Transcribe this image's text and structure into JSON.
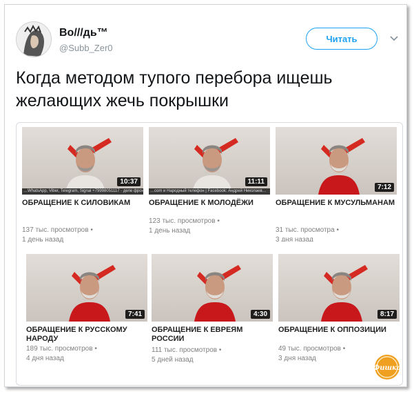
{
  "tweet": {
    "display_name": "Во///дь™",
    "handle": "@Subb_Zer0",
    "follow_label": "Читать",
    "text": "Когда методом тупого перебора ищешь желающих жечь покрышки"
  },
  "videos": [
    {
      "title": "ОБРАЩЕНИЕ К СИЛОВИКАМ",
      "views": "137 тыс. просмотров •",
      "age": "1 день назад",
      "duration": "10:37",
      "ticker": "…WhatsApp, Viber, Telegram, Signal +79998051117 · деле фронт…"
    },
    {
      "title": "ОБРАЩЕНИЕ К МОЛОДЁЖИ",
      "views": "123 тыс. просмотров •",
      "age": "1 день назад",
      "duration": "11:11",
      "ticker": "…com и Народный телефон | Facebook: Андрей Николаев…"
    },
    {
      "title": "ОБРАЩЕНИЕ К МУСУЛЬМАНАМ",
      "views": "31 тыс. просмотра •",
      "age": "3 дня назад",
      "duration": "7:12",
      "ticker": ""
    },
    {
      "title": "ОБРАЩЕНИЕ К РУССКОМУ НАРОДУ",
      "views": "189 тыс. просмотров •",
      "age": "4 дня назад",
      "duration": "7:41",
      "ticker": ""
    },
    {
      "title": "ОБРАЩЕНИЕ К ЕВРЕЯМ РОССИИ",
      "views": "111 тыс. просмотров •",
      "age": "5 дней назад",
      "duration": "4:30",
      "ticker": ""
    },
    {
      "title": "ОБРАЩЕНИЕ К ОППОЗИЦИИ",
      "views": "49 тыс. просмотров •",
      "age": "3 дня назад",
      "duration": "8:17",
      "ticker": ""
    }
  ],
  "watermark": {
    "text": "Фишка"
  },
  "colors": {
    "accent": "#1da1f2",
    "shirt_red": "#c8181c",
    "flag_red": "#d42a22"
  }
}
